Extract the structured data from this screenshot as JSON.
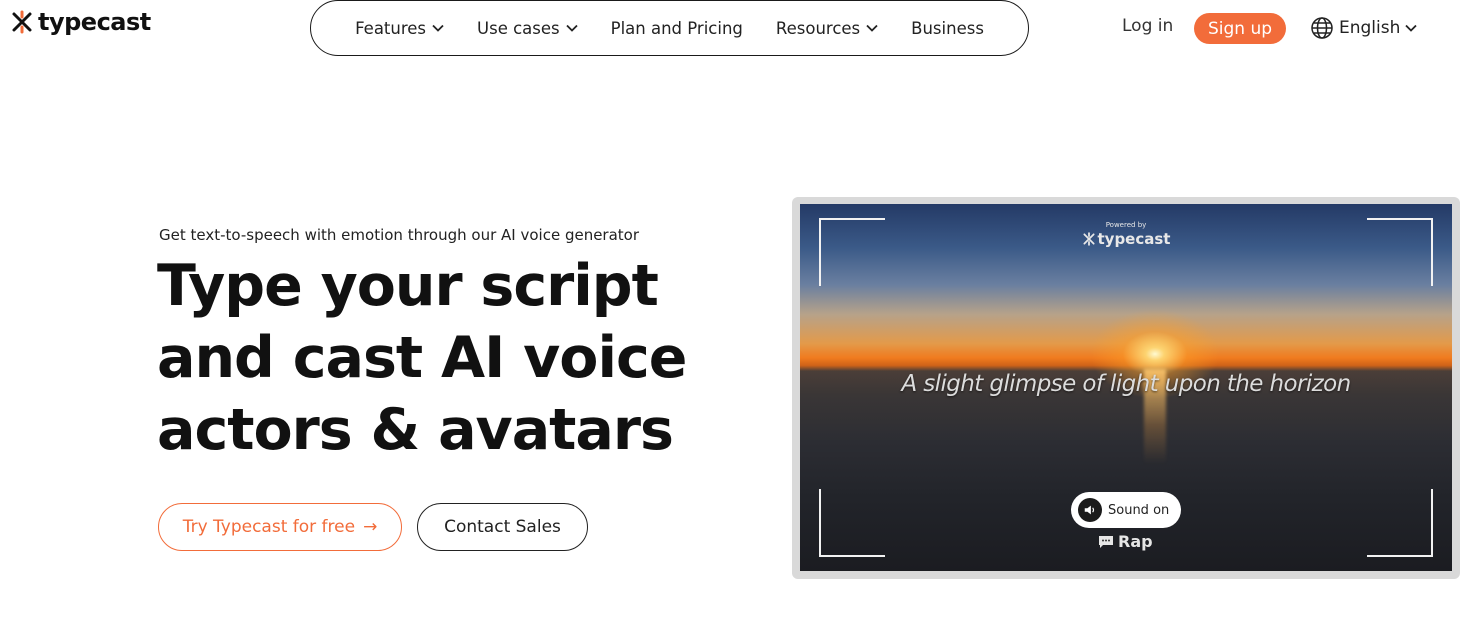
{
  "header": {
    "logo_text": "typecast",
    "nav": [
      {
        "label": "Features",
        "dropdown": true
      },
      {
        "label": "Use cases",
        "dropdown": true
      },
      {
        "label": "Plan and Pricing",
        "dropdown": false
      },
      {
        "label": "Resources",
        "dropdown": true
      },
      {
        "label": "Business",
        "dropdown": false
      }
    ],
    "login_label": "Log in",
    "signup_label": "Sign up",
    "language_label": "English"
  },
  "hero": {
    "subtitle": "Get text-to-speech with emotion through our AI voice generator",
    "headline_lines": [
      "Type your script",
      "and cast AI voice",
      "actors & avatars"
    ],
    "try_button": "Try Typecast for free",
    "try_arrow": "→",
    "contact_button": "Contact Sales"
  },
  "video": {
    "powered_by": "Powered by",
    "brand": "typecast",
    "caption": "A slight glimpse of light upon the horizon",
    "sound_label": "Sound on",
    "style_label": "Rap"
  },
  "icons": {
    "logo": "typecast-logo-icon",
    "chevron": "chevron-down-icon",
    "globe": "globe-icon",
    "speaker": "speaker-icon",
    "chat": "chat-bubble-icon"
  },
  "colors": {
    "accent": "#f26c3a",
    "text": "#111111",
    "frame": "#d9d9d9"
  }
}
